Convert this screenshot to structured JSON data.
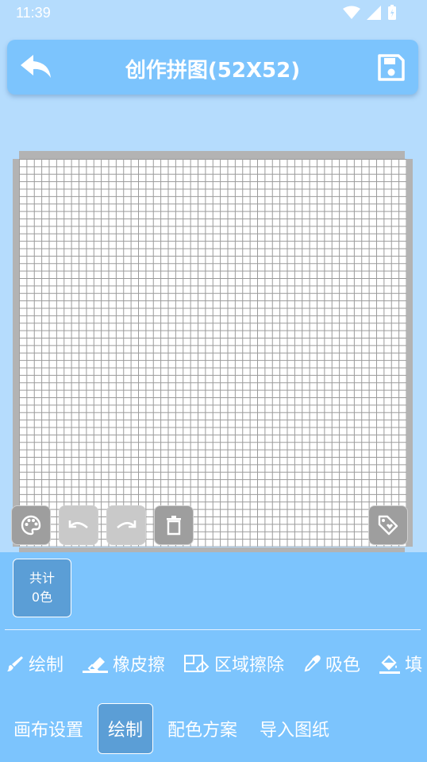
{
  "status": {
    "time": "11:39"
  },
  "header": {
    "title": "创作拼图(52X52)"
  },
  "bottom": {
    "count_label": "共计",
    "count_value": "0色"
  },
  "tools": [
    {
      "label": "绘制",
      "icon": "brush-icon"
    },
    {
      "label": "橡皮擦",
      "icon": "eraser-icon"
    },
    {
      "label": "区域擦除",
      "icon": "area-erase-icon"
    },
    {
      "label": "吸色",
      "icon": "eyedropper-icon"
    },
    {
      "label": "填",
      "icon": "fill-bucket-icon"
    }
  ],
  "tabs": [
    {
      "label": "画布设置"
    },
    {
      "label": "绘制"
    },
    {
      "label": "配色方案"
    },
    {
      "label": "导入图纸"
    }
  ],
  "colors": {
    "background": "#b5dcfd",
    "accent": "#7cc4fd",
    "active": "#5b9ed6"
  }
}
